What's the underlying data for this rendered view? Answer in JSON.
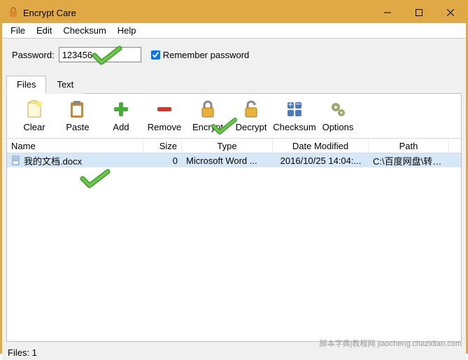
{
  "window": {
    "title": "Encrypt Care"
  },
  "menus": [
    "File",
    "Edit",
    "Checksum",
    "Help"
  ],
  "password": {
    "label": "Password:",
    "value": "123456",
    "remember_label": "Remember password",
    "remember_checked": true
  },
  "tabs": {
    "files": "Files",
    "text": "Text"
  },
  "toolbar": {
    "clear": "Clear",
    "paste": "Paste",
    "add": "Add",
    "remove": "Remove",
    "encrypt": "Encrypt",
    "decrypt": "Decrypt",
    "checksum": "Checksum",
    "options": "Options"
  },
  "columns": {
    "name": "Name",
    "size": "Size",
    "type": "Type",
    "date": "Date Modified",
    "path": "Path"
  },
  "rows": [
    {
      "name": "我的文档.docx",
      "size": "0",
      "type": "Microsoft Word ...",
      "date": "2016/10/25 14:04:...",
      "path": "C:\\百度网盘\\转型升..."
    }
  ],
  "status": "Files: 1",
  "watermark": "脚本字典|教程网 jiaocheng.chazidian.com"
}
